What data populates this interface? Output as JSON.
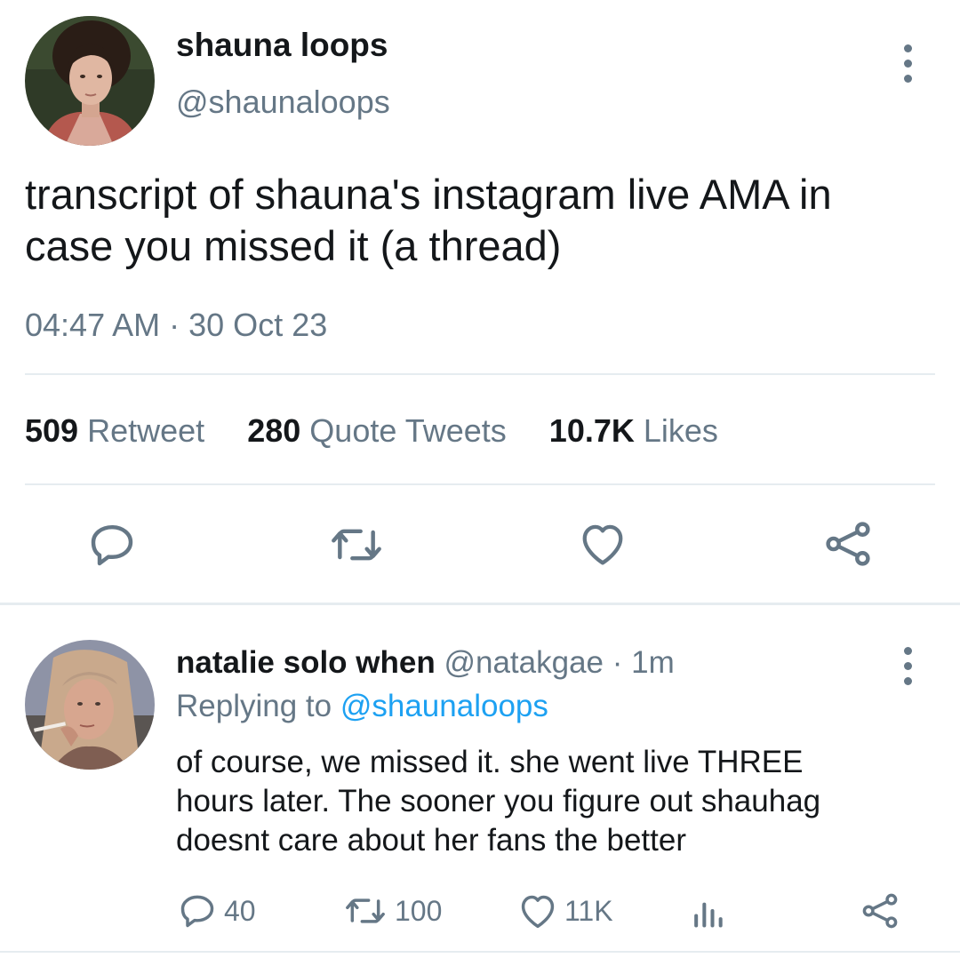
{
  "main_tweet": {
    "display_name": "shauna loops",
    "handle": "@shaunaloops",
    "text_line1": "transcript of shauna's instagram live AMA in",
    "text_line2": "case you missed it (a thread)",
    "time": "04:47 AM",
    "separator": "·",
    "date": "30 Oct 23",
    "stats": {
      "retweets_count": "509",
      "retweets_label": "Retweet",
      "quotes_count": "280",
      "quotes_label": "Quote Tweets",
      "likes_count": "10.7K",
      "likes_label": "Likes"
    },
    "icons": [
      "reply-icon",
      "retweet-icon",
      "like-icon",
      "share-icon"
    ]
  },
  "reply": {
    "display_name": "natalie solo when",
    "handle": "@natakgae",
    "separator": "·",
    "time": "1m",
    "replying_to_label": "Replying to",
    "replying_to_handle": "@shaunaloops",
    "text_line1": "of course, we missed it. she went live THREE",
    "text_line2": "hours later. The sooner you figure out shauhag",
    "text_line3": "doesnt care about her fans the better",
    "actions": {
      "replies": "40",
      "retweets": "100",
      "likes": "11K"
    },
    "icons": [
      "reply-icon",
      "retweet-icon",
      "like-icon",
      "analytics-icon",
      "share-icon"
    ]
  },
  "colors": {
    "text": "#14171a",
    "secondary": "#657786",
    "link": "#1da1f2",
    "divider": "#e6ecf0"
  }
}
